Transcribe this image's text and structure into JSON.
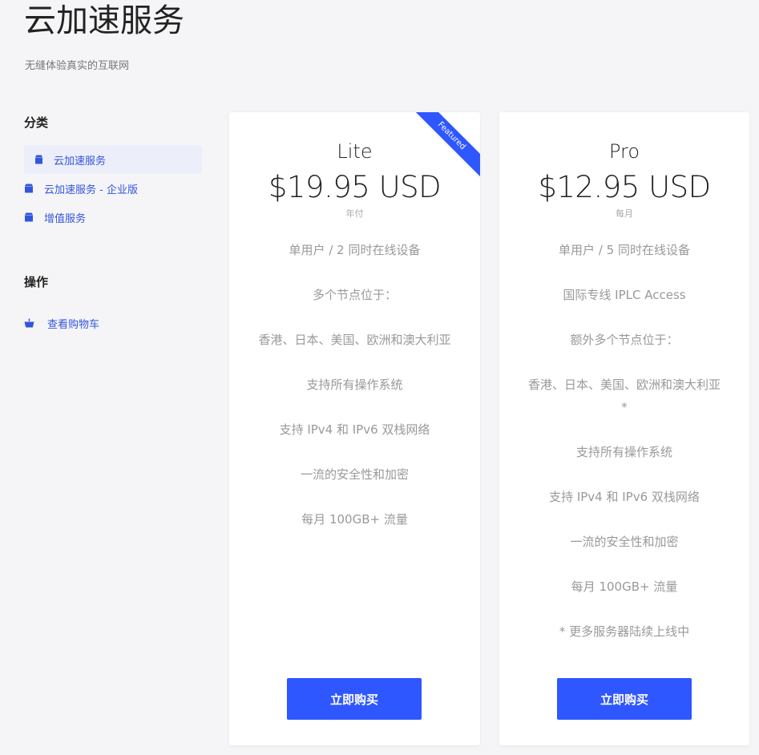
{
  "header": {
    "title": "云加速服务",
    "subtitle": "无缝体验真实的互联网"
  },
  "sidebar": {
    "categories_heading": "分类",
    "categories": [
      {
        "label": "云加速服务",
        "icon": "box-icon",
        "active": true
      },
      {
        "label": "云加速服务 - 企业版",
        "icon": "box-icon",
        "active": false
      },
      {
        "label": "增值服务",
        "icon": "box-icon",
        "active": false
      }
    ],
    "actions_heading": "操作",
    "actions": [
      {
        "label": "查看购物车",
        "icon": "basket-icon"
      }
    ]
  },
  "plans": [
    {
      "name": "Lite",
      "price": "$19.95 USD",
      "period": "年付",
      "badge": "Featured",
      "features": [
        "单用户 / 2 同时在线设备",
        "多个节点位于：",
        "香港、日本、美国、欧洲和澳大利亚",
        "支持所有操作系统",
        "支持 IPv4 和 IPv6 双栈网络",
        "一流的安全性和加密",
        "每月 100GB+ 流量"
      ],
      "button_label": "立即购买"
    },
    {
      "name": "Pro",
      "price": "$12.95 USD",
      "period": "每月",
      "features": [
        "单用户 / 5 同时在线设备",
        "国际专线 IPLC Access",
        "额外多个节点位于：",
        "香港、日本、美国、欧洲和澳大利亚*",
        "支持所有操作系统",
        "支持 IPv4 和 IPv6 双栈网络",
        "一流的安全性和加密",
        "每月 100GB+ 流量",
        "* 更多服务器陆续上线中"
      ],
      "button_label": "立即购买"
    }
  ],
  "colors": {
    "accent": "#2f57ff",
    "link": "#3355dd",
    "background": "#f5f5f7"
  }
}
